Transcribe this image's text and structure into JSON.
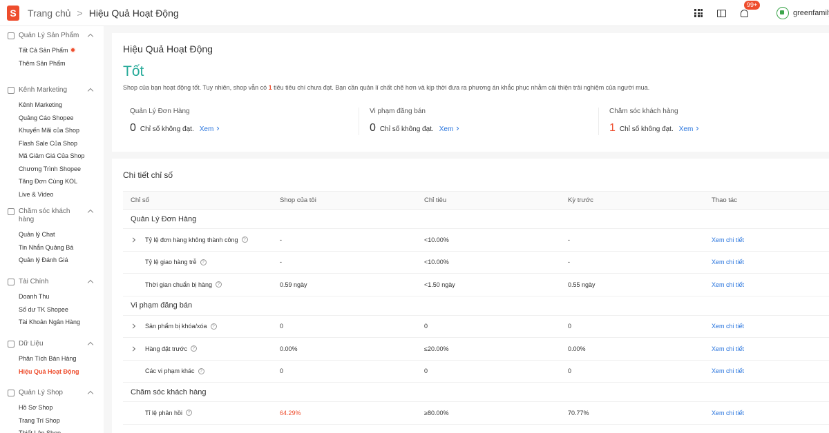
{
  "header": {
    "logo": "S",
    "breadcrumb_home": "Trang chủ",
    "breadcrumb_separator": ">",
    "breadcrumb_current": "Hiệu Quả Hoạt Động",
    "notification_badge": "99+",
    "username": "greenfamily_"
  },
  "sidebar": [
    {
      "title": "Quản Lý Sản Phẩm",
      "icon": "box-icon",
      "items": [
        {
          "label": "Tất Cả Sản Phẩm",
          "dot": true
        },
        {
          "label": "Thêm Sản Phẩm"
        }
      ]
    },
    {
      "title": "Kênh Marketing",
      "icon": "tag-icon",
      "items": [
        {
          "label": "Kênh Marketing"
        },
        {
          "label": "Quảng Cáo Shopee"
        },
        {
          "label": "Khuyến Mãi của Shop"
        },
        {
          "label": "Flash Sale Của Shop"
        },
        {
          "label": "Mã Giảm Giá Của Shop"
        },
        {
          "label": "Chương Trình Shopee"
        },
        {
          "label": "Tăng Đơn Cùng KOL"
        },
        {
          "label": "Live & Video"
        }
      ]
    },
    {
      "title": "Chăm sóc khách hàng",
      "icon": "chat-icon",
      "items": [
        {
          "label": "Quản lý Chat"
        },
        {
          "label": "Tin Nhắn Quảng Bá"
        },
        {
          "label": "Quản lý Đánh Giá"
        }
      ]
    },
    {
      "title": "Tài Chính",
      "icon": "wallet-icon",
      "items": [
        {
          "label": "Doanh Thu"
        },
        {
          "label": "Số dư TK Shopee"
        },
        {
          "label": "Tài Khoản Ngân Hàng"
        }
      ]
    },
    {
      "title": "Dữ Liệu",
      "icon": "chart-icon",
      "items": [
        {
          "label": "Phân Tích Bán Hàng"
        },
        {
          "label": "Hiệu Quả Hoạt Động",
          "active": true
        }
      ]
    },
    {
      "title": "Quản Lý Shop",
      "icon": "shop-icon",
      "items": [
        {
          "label": "Hồ Sơ Shop"
        },
        {
          "label": "Trang Trí Shop"
        },
        {
          "label": "Thiết Lập Shop"
        }
      ]
    }
  ],
  "summary": {
    "title": "Hiệu Quả Hoạt Động",
    "status": "Tốt",
    "description_before": "Shop của bạn hoạt động tốt. Tuy nhiên, shop vẫn có ",
    "description_count": "1",
    "description_after": " tiêu tiêu chí chưa đạt. Bạn cần quản lí chất chẽ hơn và kịp thời đưa ra phương án khắc phục nhằm cải thiện trải nghiệm của người mua.",
    "metrics": [
      {
        "title": "Quản Lý Đơn Hàng",
        "count": "0",
        "text": "Chỉ số không đạt.",
        "link": "Xem",
        "bad": false
      },
      {
        "title": "Vi phạm đăng bán",
        "count": "0",
        "text": "Chỉ số không đạt.",
        "link": "Xem",
        "bad": false
      },
      {
        "title": "Chăm sóc khách hàng",
        "count": "1",
        "text": "Chỉ số không đạt.",
        "link": "Xem",
        "bad": true
      }
    ]
  },
  "details": {
    "title": "Chi tiết chỉ số",
    "columns": [
      "Chỉ số",
      "Shop của tôi",
      "Chỉ tiêu",
      "Kỳ trước",
      "Thao tác"
    ],
    "groups": [
      {
        "name": "Quản Lý Đơn Hàng",
        "rows": [
          {
            "name": "Tỷ lệ đơn hàng không thành công",
            "expand": true,
            "shop": "-",
            "target": "<10.00%",
            "prev": "-",
            "action": "Xem chi tiết"
          },
          {
            "name": "Tỷ lệ giao hàng trễ",
            "expand": false,
            "shop": "-",
            "target": "<10.00%",
            "prev": "-",
            "action": "Xem chi tiết"
          },
          {
            "name": "Thời gian chuẩn bị hàng",
            "expand": false,
            "shop": "0.59 ngày",
            "target": "<1.50 ngày",
            "prev": "0.55 ngày",
            "action": "Xem chi tiết"
          }
        ]
      },
      {
        "name": "Vi phạm đăng bán",
        "rows": [
          {
            "name": "Sản phẩm bị khóa/xóa",
            "expand": true,
            "shop": "0",
            "target": "0",
            "prev": "0",
            "action": "Xem chi tiết"
          },
          {
            "name": "Hàng đặt trước",
            "expand": true,
            "shop": "0.00%",
            "target": "≤20.00%",
            "prev": "0.00%",
            "action": "Xem chi tiết"
          },
          {
            "name": "Các vi phạm khác",
            "expand": false,
            "shop": "0",
            "target": "0",
            "prev": "0",
            "action": "Xem chi tiết"
          }
        ]
      },
      {
        "name": "Chăm sóc khách hàng",
        "rows": [
          {
            "name": "Tỉ lệ phản hồi",
            "expand": false,
            "shop": "64.29%",
            "shop_bad": true,
            "target": "≥80.00%",
            "prev": "70.77%",
            "action": "Xem chi tiết"
          }
        ]
      }
    ]
  },
  "colors": {
    "accent": "#ee4d2d",
    "status_good": "#26aa99",
    "link": "#2673dd"
  }
}
